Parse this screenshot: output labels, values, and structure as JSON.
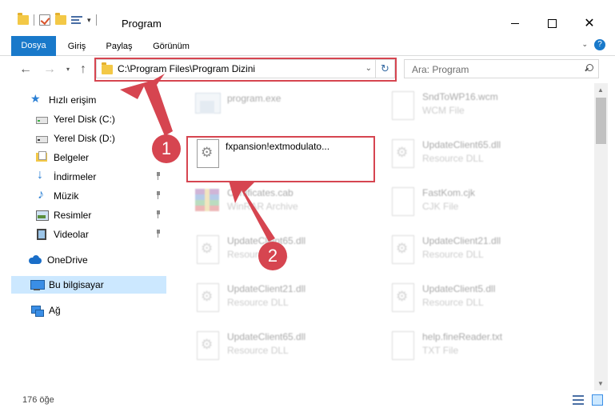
{
  "window": {
    "title": "Program",
    "qat_dropdown": "▾",
    "minimize_icon": "",
    "close_icon": "✕"
  },
  "ribbon": {
    "tabs": [
      "Dosya",
      "Giriş",
      "Paylaş",
      "Görünüm"
    ],
    "help_label": "?",
    "collapse_icon": "⌄"
  },
  "nav": {
    "back_icon": "←",
    "forward_icon": "→",
    "recent_icon": "▾",
    "up_icon": "↑",
    "address": "C:\\Program Files\\Program Dizini",
    "address_dropdown": "⌄",
    "refresh_icon": "↻",
    "search_placeholder": "Ara: Program"
  },
  "sidebar": {
    "items": [
      {
        "label": "Hızlı erişim",
        "icon": "star-icon"
      },
      {
        "label": "Yerel Disk (C:)",
        "icon": "disk-icon"
      },
      {
        "label": "Yerel Disk (D:)",
        "icon": "disk-icon"
      },
      {
        "label": "Belgeler",
        "icon": "documents-icon"
      },
      {
        "label": "İndirmeler",
        "icon": "download-icon"
      },
      {
        "label": "Müzik",
        "icon": "music-icon"
      },
      {
        "label": "Resimler",
        "icon": "pictures-icon"
      },
      {
        "label": "Videolar",
        "icon": "video-icon"
      },
      {
        "label": "OneDrive",
        "icon": "cloud-icon"
      },
      {
        "label": "Bu bilgisayar",
        "icon": "computer-icon"
      },
      {
        "label": "Ağ",
        "icon": "network-icon"
      }
    ]
  },
  "files": {
    "left": [
      {
        "name": "program.exe",
        "type": ""
      },
      {
        "name": "fxpansion!extmodulato...",
        "type": ""
      },
      {
        "name": "Certificates.cab",
        "type": "WinRAR Archive"
      },
      {
        "name": "UpdateClient65.dll",
        "type": "Resource DLL"
      },
      {
        "name": "UpdateClient21.dll",
        "type": "Resource DLL"
      },
      {
        "name": "UpdateClient65.dll",
        "type": "Resource DLL"
      }
    ],
    "right": [
      {
        "name": "SndToWP16.wcm",
        "type": "WCM File"
      },
      {
        "name": "UpdateClient65.dll",
        "type": "Resource DLL"
      },
      {
        "name": "FastKom.cjk",
        "type": "CJK File"
      },
      {
        "name": "UpdateClient21.dll",
        "type": "Resource DLL"
      },
      {
        "name": "UpdateClient5.dll",
        "type": "Resource DLL"
      },
      {
        "name": "help.fineReader.txt",
        "type": "TXT File"
      }
    ]
  },
  "callouts": [
    "1",
    "2"
  ],
  "status": {
    "item_count": "176 öğe"
  },
  "scrollbar": {
    "up_icon": "▲",
    "down_icon": "▼"
  },
  "colors": {
    "accent": "#1979ca",
    "highlight": "#d64550",
    "selected": "#cce8ff"
  }
}
